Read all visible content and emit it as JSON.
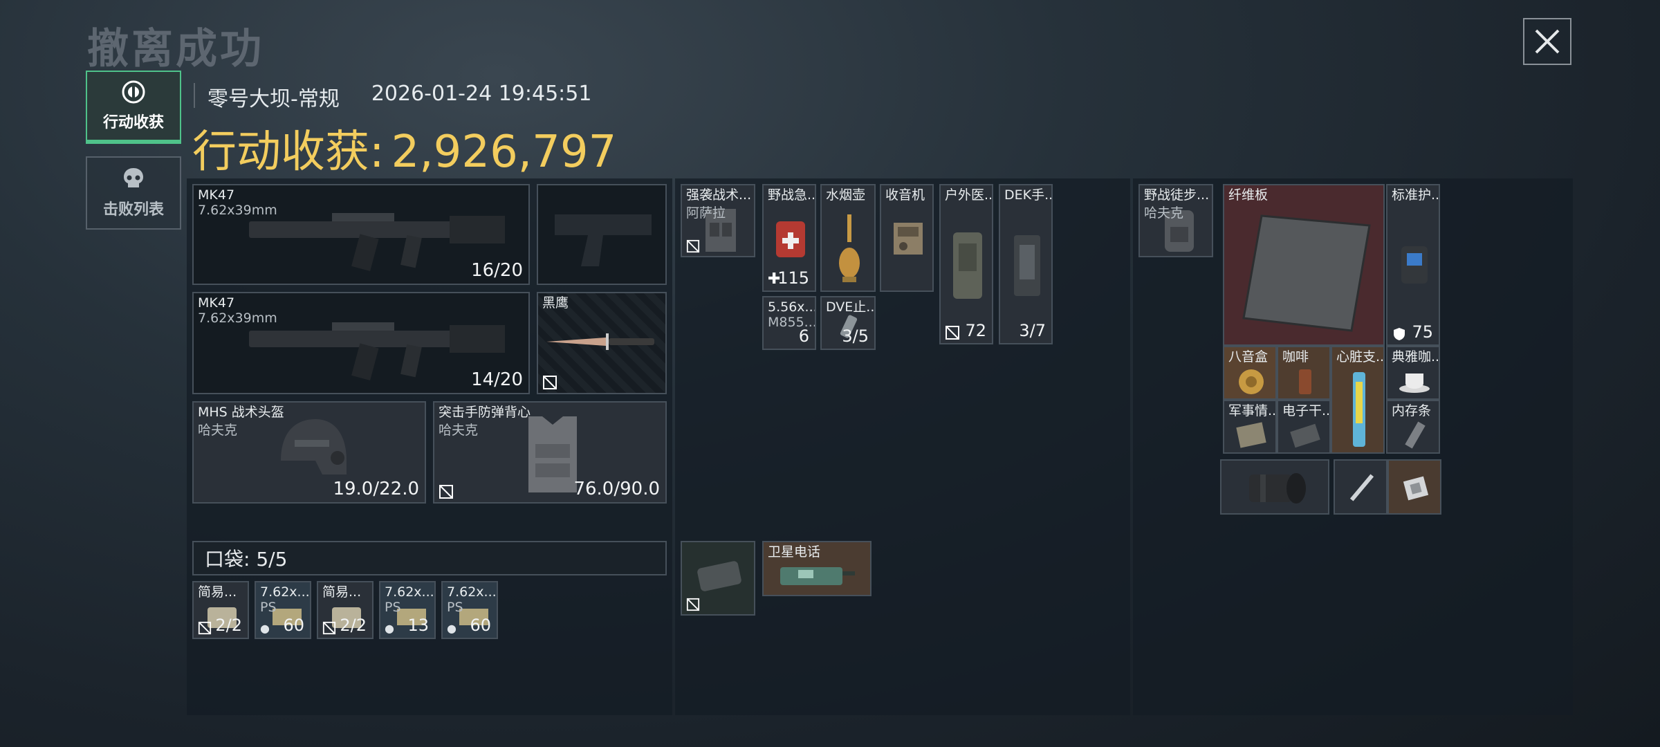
{
  "header": {
    "title": "撤离成功",
    "map": "零号大坝-常规",
    "datetime": "2026-01-24 19:45:51",
    "income_label": "行动收获:",
    "income_value": "2,926,797"
  },
  "tabs": [
    {
      "label": "行动收获",
      "icon": "coin-icon",
      "active": true
    },
    {
      "label": "击败列表",
      "icon": "skull-icon",
      "active": false
    }
  ],
  "gear": {
    "primary1": {
      "name": "MK47",
      "sub": "7.62x39mm",
      "ammo": "16/20"
    },
    "primary2": {
      "name": "MK47",
      "sub": "7.62x39mm",
      "ammo": "14/20"
    },
    "melee": {
      "name": "黑鹰"
    },
    "helmet": {
      "name": "MHS 战术头盔",
      "sub": "哈夫克",
      "durability": "19.0/22.0"
    },
    "armor": {
      "name": "突击手防弹背心",
      "sub": "哈夫克",
      "durability": "76.0/90.0"
    },
    "pocket_label": "口袋: 5/5",
    "pockets": [
      {
        "name": "简易...",
        "count": "2/2"
      },
      {
        "name": "7.62x...",
        "sub": "PS",
        "count": "60"
      },
      {
        "name": "简易...",
        "count": "2/2"
      },
      {
        "name": "7.62x...",
        "sub": "PS",
        "count": "13"
      },
      {
        "name": "7.62x...",
        "sub": "PS",
        "count": "60"
      }
    ]
  },
  "rig": {
    "chest": {
      "name": "强袭战术...",
      "sub": "阿萨拉"
    },
    "items": [
      {
        "name": "野战急...",
        "count": "115"
      },
      {
        "name": "水烟壶"
      },
      {
        "name": "收音机"
      },
      {
        "name": "户外医...",
        "count": "72"
      },
      {
        "name": "DEK手...",
        "count": "3/7"
      },
      {
        "name": "5.56x...",
        "sub": "M855...",
        "count": "6"
      },
      {
        "name": "DVE止...",
        "count": "3/5"
      }
    ],
    "phone": {
      "name": "卫星电话"
    }
  },
  "backpack": {
    "bag": {
      "name": "野战徒步...",
      "sub": "哈夫克"
    },
    "items": [
      {
        "name": "纤维板"
      },
      {
        "name": "标准护...",
        "count": "75"
      },
      {
        "name": "八音盒"
      },
      {
        "name": "咖啡"
      },
      {
        "name": "心脏支..."
      },
      {
        "name": "典雅咖..."
      },
      {
        "name": "军事情..."
      },
      {
        "name": "电子干..."
      },
      {
        "name": "内存条"
      }
    ]
  }
}
